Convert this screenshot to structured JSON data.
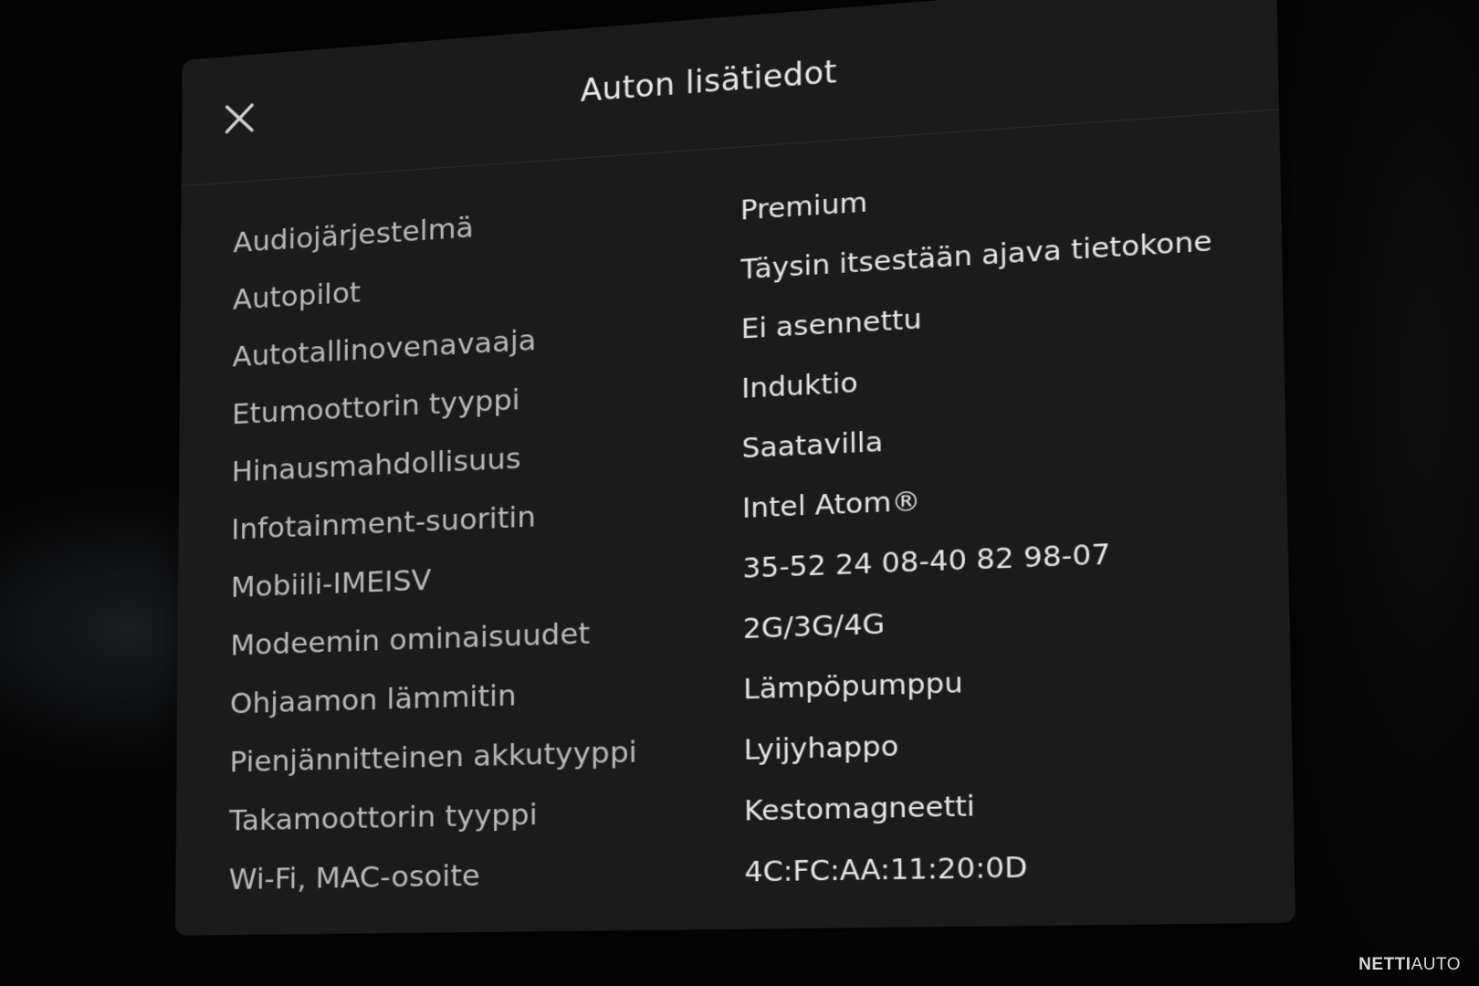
{
  "dialog": {
    "title": "Auton lisätiedot",
    "close_icon": "close-icon",
    "rows": [
      {
        "label": "Audiojärjestelmä",
        "value": "Premium"
      },
      {
        "label": "Autopilot",
        "value": "Täysin itsestään ajava tietokone"
      },
      {
        "label": "Autotallinovenavaaja",
        "value": "Ei asennettu"
      },
      {
        "label": "Etumoottorin tyyppi",
        "value": "Induktio"
      },
      {
        "label": "Hinausmahdollisuus",
        "value": "Saatavilla"
      },
      {
        "label": "Infotainment-suoritin",
        "value": "Intel Atom®"
      },
      {
        "label": "Mobiili-IMEISV",
        "value": "35-52 24 08-40 82 98-07"
      },
      {
        "label": "Modeemin ominaisuudet",
        "value": "2G/3G/4G"
      },
      {
        "label": "Ohjaamon lämmitin",
        "value": "Lämpöpumppu"
      },
      {
        "label": "Pienjännitteinen akkutyyppi",
        "value": "Lyijyhappo"
      },
      {
        "label": "Takamoottorin tyyppi",
        "value": "Kestomagneetti"
      },
      {
        "label": "Wi-Fi, MAC-osoite",
        "value": "4C:FC:AA:11:20:0D"
      }
    ]
  },
  "watermark": {
    "part1": "NETTI",
    "part2": "AUTO"
  },
  "colors": {
    "background": "#050505",
    "panel": "#1b1b1b",
    "label_text": "#b9b9b9",
    "value_text": "#e6e6e6"
  }
}
